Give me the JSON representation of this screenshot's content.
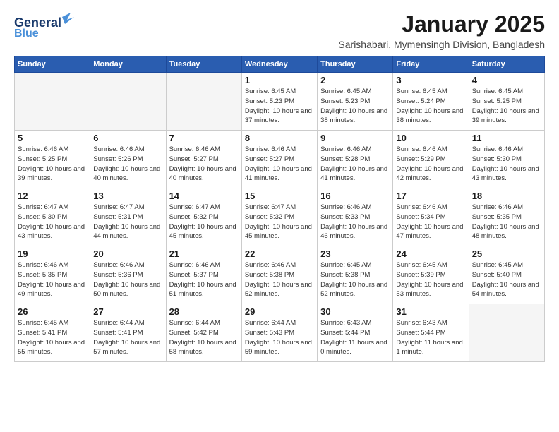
{
  "header": {
    "logo_line1": "General",
    "logo_line2": "Blue",
    "title": "January 2025",
    "subtitle": "Sarishabari, Mymensingh Division, Bangladesh"
  },
  "calendar": {
    "days_of_week": [
      "Sunday",
      "Monday",
      "Tuesday",
      "Wednesday",
      "Thursday",
      "Friday",
      "Saturday"
    ],
    "weeks": [
      [
        {
          "day": "",
          "empty": true
        },
        {
          "day": "",
          "empty": true
        },
        {
          "day": "",
          "empty": true
        },
        {
          "day": "1",
          "sunrise": "6:45 AM",
          "sunset": "5:23 PM",
          "daylight": "10 hours and 37 minutes."
        },
        {
          "day": "2",
          "sunrise": "6:45 AM",
          "sunset": "5:23 PM",
          "daylight": "10 hours and 38 minutes."
        },
        {
          "day": "3",
          "sunrise": "6:45 AM",
          "sunset": "5:24 PM",
          "daylight": "10 hours and 38 minutes."
        },
        {
          "day": "4",
          "sunrise": "6:45 AM",
          "sunset": "5:25 PM",
          "daylight": "10 hours and 39 minutes."
        }
      ],
      [
        {
          "day": "5",
          "sunrise": "6:46 AM",
          "sunset": "5:25 PM",
          "daylight": "10 hours and 39 minutes."
        },
        {
          "day": "6",
          "sunrise": "6:46 AM",
          "sunset": "5:26 PM",
          "daylight": "10 hours and 40 minutes."
        },
        {
          "day": "7",
          "sunrise": "6:46 AM",
          "sunset": "5:27 PM",
          "daylight": "10 hours and 40 minutes."
        },
        {
          "day": "8",
          "sunrise": "6:46 AM",
          "sunset": "5:27 PM",
          "daylight": "10 hours and 41 minutes."
        },
        {
          "day": "9",
          "sunrise": "6:46 AM",
          "sunset": "5:28 PM",
          "daylight": "10 hours and 41 minutes."
        },
        {
          "day": "10",
          "sunrise": "6:46 AM",
          "sunset": "5:29 PM",
          "daylight": "10 hours and 42 minutes."
        },
        {
          "day": "11",
          "sunrise": "6:46 AM",
          "sunset": "5:30 PM",
          "daylight": "10 hours and 43 minutes."
        }
      ],
      [
        {
          "day": "12",
          "sunrise": "6:47 AM",
          "sunset": "5:30 PM",
          "daylight": "10 hours and 43 minutes."
        },
        {
          "day": "13",
          "sunrise": "6:47 AM",
          "sunset": "5:31 PM",
          "daylight": "10 hours and 44 minutes."
        },
        {
          "day": "14",
          "sunrise": "6:47 AM",
          "sunset": "5:32 PM",
          "daylight": "10 hours and 45 minutes."
        },
        {
          "day": "15",
          "sunrise": "6:47 AM",
          "sunset": "5:32 PM",
          "daylight": "10 hours and 45 minutes."
        },
        {
          "day": "16",
          "sunrise": "6:46 AM",
          "sunset": "5:33 PM",
          "daylight": "10 hours and 46 minutes."
        },
        {
          "day": "17",
          "sunrise": "6:46 AM",
          "sunset": "5:34 PM",
          "daylight": "10 hours and 47 minutes."
        },
        {
          "day": "18",
          "sunrise": "6:46 AM",
          "sunset": "5:35 PM",
          "daylight": "10 hours and 48 minutes."
        }
      ],
      [
        {
          "day": "19",
          "sunrise": "6:46 AM",
          "sunset": "5:35 PM",
          "daylight": "10 hours and 49 minutes."
        },
        {
          "day": "20",
          "sunrise": "6:46 AM",
          "sunset": "5:36 PM",
          "daylight": "10 hours and 50 minutes."
        },
        {
          "day": "21",
          "sunrise": "6:46 AM",
          "sunset": "5:37 PM",
          "daylight": "10 hours and 51 minutes."
        },
        {
          "day": "22",
          "sunrise": "6:46 AM",
          "sunset": "5:38 PM",
          "daylight": "10 hours and 52 minutes."
        },
        {
          "day": "23",
          "sunrise": "6:45 AM",
          "sunset": "5:38 PM",
          "daylight": "10 hours and 52 minutes."
        },
        {
          "day": "24",
          "sunrise": "6:45 AM",
          "sunset": "5:39 PM",
          "daylight": "10 hours and 53 minutes."
        },
        {
          "day": "25",
          "sunrise": "6:45 AM",
          "sunset": "5:40 PM",
          "daylight": "10 hours and 54 minutes."
        }
      ],
      [
        {
          "day": "26",
          "sunrise": "6:45 AM",
          "sunset": "5:41 PM",
          "daylight": "10 hours and 55 minutes."
        },
        {
          "day": "27",
          "sunrise": "6:44 AM",
          "sunset": "5:41 PM",
          "daylight": "10 hours and 57 minutes."
        },
        {
          "day": "28",
          "sunrise": "6:44 AM",
          "sunset": "5:42 PM",
          "daylight": "10 hours and 58 minutes."
        },
        {
          "day": "29",
          "sunrise": "6:44 AM",
          "sunset": "5:43 PM",
          "daylight": "10 hours and 59 minutes."
        },
        {
          "day": "30",
          "sunrise": "6:43 AM",
          "sunset": "5:44 PM",
          "daylight": "11 hours and 0 minutes."
        },
        {
          "day": "31",
          "sunrise": "6:43 AM",
          "sunset": "5:44 PM",
          "daylight": "11 hours and 1 minute."
        },
        {
          "day": "",
          "empty": true
        }
      ]
    ]
  }
}
